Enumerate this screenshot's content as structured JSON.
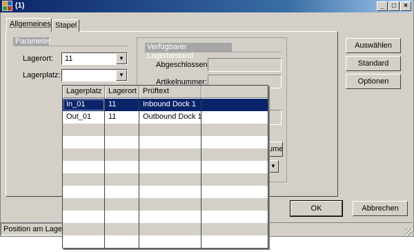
{
  "window": {
    "title": "(1)",
    "controls": [
      "_",
      "□",
      "×"
    ]
  },
  "tabs": [
    {
      "label": "Allgemeines"
    },
    {
      "label": "Stapel"
    }
  ],
  "parameter": {
    "title": "Parameter",
    "lagerort_label": "Lagerort:",
    "lagerort_value": "11",
    "lagerplatz_label": "Lagerplatz:",
    "lagerplatz_value": ""
  },
  "bestand": {
    "title": "Verfügbarer Lagerbestand",
    "abgeschlossen_label": "Abgeschlossen:",
    "artikelnummer_label": "Artikelnummer:",
    "partial_button": "ume"
  },
  "side_buttons": {
    "auswaehlen": "Auswählen",
    "standard": "Standard",
    "optionen": "Optionen"
  },
  "footer_buttons": {
    "ok": "OK",
    "abbrechen": "Abbrechen"
  },
  "status": {
    "text": "Position am Lagerort"
  },
  "lookup": {
    "columns": [
      "Lagerplatz",
      "Lagerort",
      "Prüftext",
      ""
    ],
    "rows": [
      {
        "lagerplatz": "In_01",
        "lagerort": "11",
        "prueftext": "Inbound Dock 1",
        "selected": true
      },
      {
        "lagerplatz": "Out_01",
        "lagerort": "11",
        "prueftext": "Outbound Dock 1",
        "selected": false
      }
    ],
    "selection_color": "#0a246a"
  }
}
